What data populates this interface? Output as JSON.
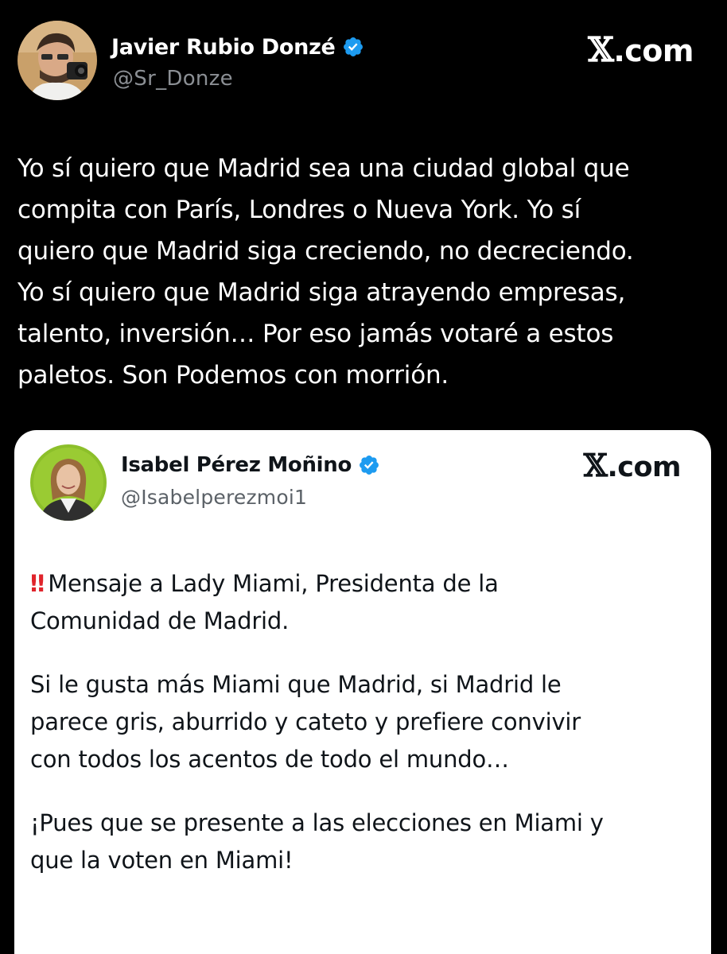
{
  "tweet": {
    "display_name": "Javier Rubio Donzé",
    "handle": "@Sr_Donze",
    "brand": "X.com",
    "verified_icon": "verified-badge-icon",
    "lines": [
      "Yo sí quiero que Madrid sea una ciudad global que",
      "compita con París, Londres o Nueva York. Yo sí",
      "quiero que Madrid siga creciendo, no decreciendo.",
      "Yo sí quiero que Madrid siga atrayendo empresas,",
      "talento, inversión… Por eso jamás votaré a estos",
      "paletos. Son Podemos con morrión."
    ]
  },
  "quoted_tweet": {
    "display_name": "Isabel Pérez Moñino",
    "handle": "@Isabelperezmoi1",
    "brand": "X.com",
    "verified_icon": "verified-badge-icon",
    "alert_icon": "double-exclamation-icon",
    "alert_glyph": "‼",
    "paragraphs": [
      [
        "Mensaje a Lady Miami, Presidenta de la",
        "Comunidad de Madrid."
      ],
      [
        "Si le gusta más Miami que Madrid, si Madrid le",
        "parece gris, aburrido y cateto y prefiere convivir",
        "con todos los acentos de todo el mundo…"
      ],
      [
        "¡Pues que se presente a las elecciones en Miami y",
        "que la voten en Miami!"
      ]
    ]
  },
  "colors": {
    "background": "#000000",
    "card_background": "#ffffff",
    "verified_blue": "#1d9bf0",
    "alert_red": "#e0242b",
    "handle_gray": "#8b8f94"
  }
}
